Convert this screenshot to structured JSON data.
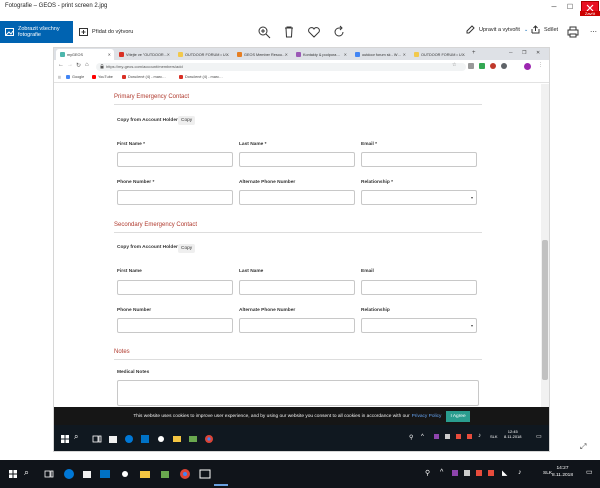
{
  "photos_app": {
    "window_title": "Fotografie – GEOS - print screen 2.jpg",
    "close_badge": "Zavřít",
    "toolbar": {
      "view_all_label": "Zobrazit všechny fotografie",
      "add_to_label": "Přidat do výtvoru",
      "edit_create_label": "Upravit a vytvořit",
      "share_label": "Sdílet"
    }
  },
  "browser": {
    "tabs": [
      {
        "label": "myGEOS",
        "favicon": "#4db6ac",
        "active": true
      },
      {
        "label": "Vítejte ve \"OUTDOOR…",
        "favicon": "#d93025"
      },
      {
        "label": "OUTDOOR FORUM • U…",
        "favicon": "#f2c94c"
      },
      {
        "label": "GEOS Member Resou…",
        "favicon": "#e67e22"
      },
      {
        "label": "Kontakty & podpora…",
        "favicon": "#9b59b6"
      },
      {
        "label": "outdoor forum sk - W…",
        "favicon": "#4285f4"
      },
      {
        "label": "OUTDOOR FORUM • U…",
        "favicon": "#f2c94c"
      }
    ],
    "url": "https://my-geos.com/account/members/add",
    "bookmarks": [
      {
        "label": "Google",
        "favicon": "#4285f4"
      },
      {
        "label": "YouTube",
        "favicon": "#ff0000"
      },
      {
        "label": "Doručené (4) - marc…",
        "favicon": "#d93025"
      },
      {
        "label": "Doručené (4) - marc…",
        "favicon": "#d93025"
      }
    ]
  },
  "form": {
    "primary": {
      "title": "Primary Emergency Contact",
      "copy_label": "Copy from Account Holder",
      "copy_button": "Copy",
      "first_name": "First Name *",
      "last_name": "Last Name *",
      "email": "Email *",
      "phone": "Phone Number *",
      "alt_phone": "Alternate Phone Number",
      "relationship": "Relationship *"
    },
    "secondary": {
      "title": "Secondary Emergency Contact",
      "copy_label": "Copy from Account Holder",
      "copy_button": "Copy",
      "first_name": "First Name",
      "last_name": "Last Name",
      "email": "Email",
      "phone": "Phone Number",
      "alt_phone": "Alternate Phone Number",
      "relationship": "Relationship"
    },
    "notes": {
      "title": "Notes",
      "medical_label": "Medical Notes"
    }
  },
  "cookie": {
    "text": "This website uses cookies to improve user experience, and by using our website you consent to all cookies in accordance with our",
    "link": "Privacy Policy",
    "button": "I Agree"
  },
  "inner_taskbar": {
    "time": "12:45",
    "date": "8.11.2018",
    "lang": "SLK"
  },
  "outer_taskbar": {
    "time": "14:27",
    "date": "8.11.2018",
    "lang": "SLK"
  }
}
